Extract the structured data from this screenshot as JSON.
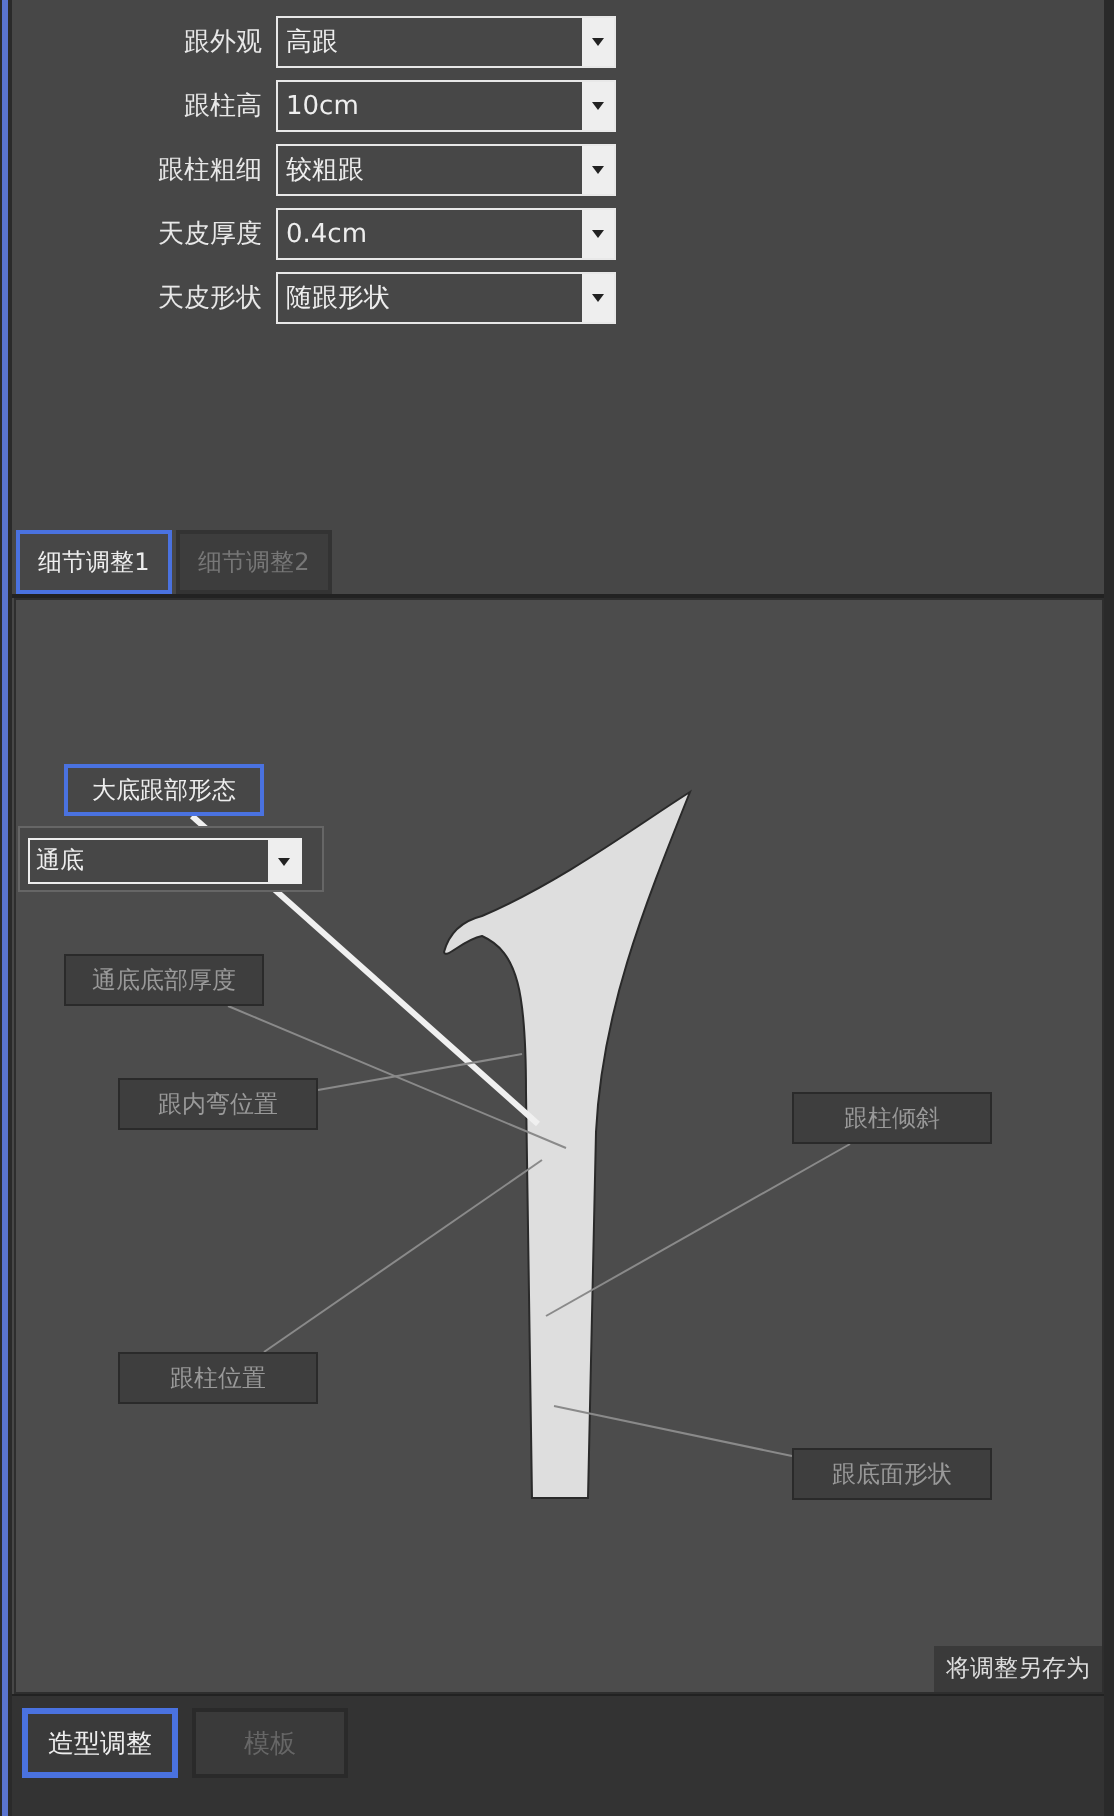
{
  "settings": [
    {
      "label": "跟外观",
      "value": "高跟"
    },
    {
      "label": "跟柱高",
      "value": "10cm"
    },
    {
      "label": "跟柱粗细",
      "value": "较粗跟"
    },
    {
      "label": "天皮厚度",
      "value": "0.4cm"
    },
    {
      "label": "天皮形状",
      "value": "随跟形状"
    }
  ],
  "detail_tabs": [
    {
      "label": "细节调整1",
      "selected": true
    },
    {
      "label": "细节调整2",
      "selected": false
    }
  ],
  "callouts": [
    {
      "label": "大底跟部形态",
      "selected": true
    },
    {
      "label": "通底底部厚度",
      "selected": false
    },
    {
      "label": "跟内弯位置",
      "selected": false
    },
    {
      "label": "跟柱倾斜",
      "selected": false
    },
    {
      "label": "跟柱位置",
      "selected": false
    },
    {
      "label": "跟底面形状",
      "selected": false
    }
  ],
  "callout_dropdown": {
    "value": "通底"
  },
  "save_as_button": "将调整另存为",
  "bottom_tabs": [
    {
      "label": "造型调整",
      "selected": true
    },
    {
      "label": "模板",
      "selected": false
    }
  ]
}
